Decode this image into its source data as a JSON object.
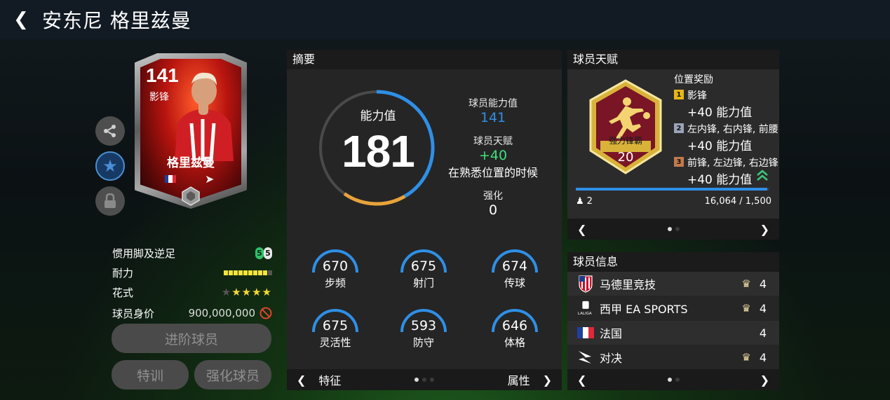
{
  "header": {
    "title": "安东尼 格里兹曼"
  },
  "card": {
    "rating": "141",
    "position": "影锋",
    "name": "格里兹曼"
  },
  "attributes": {
    "preferred_foot_label": "惯用脚及逆足",
    "foot_left": "5",
    "foot_right": "5",
    "stamina_label": "耐力",
    "stamina_level": 9,
    "skill_label": "花式",
    "skill_stars": 4,
    "value_label": "球员身价",
    "value": "900,000,000"
  },
  "buttons": {
    "advance": "进阶球员",
    "train": "特训",
    "enhance": "强化球员"
  },
  "summary": {
    "title": "摘要",
    "gauge_label": "能力值",
    "gauge_value": "181",
    "base_label": "球员能力值",
    "base_value": "141",
    "talent_label": "球员天赋",
    "talent_value": "+40",
    "talent_note": "在熟悉位置的时候",
    "enhance_label": "强化",
    "enhance_value": "0",
    "stats": [
      {
        "value": "670",
        "label": "步频"
      },
      {
        "value": "675",
        "label": "射门"
      },
      {
        "value": "674",
        "label": "传球"
      },
      {
        "value": "675",
        "label": "灵活性"
      },
      {
        "value": "593",
        "label": "防守"
      },
      {
        "value": "646",
        "label": "体格"
      }
    ],
    "footer_left": "特征",
    "footer_right": "属性"
  },
  "talent": {
    "title": "球员天赋",
    "badge_name": "强力锋霸",
    "badge_level": "20",
    "bonus_title": "位置奖励",
    "items": [
      {
        "num": "1",
        "positions": "影锋",
        "bonus": "+40 能力值",
        "color": "#e7b615"
      },
      {
        "num": "2",
        "positions": "左内锋, 右内锋, 前腰",
        "bonus": "+40 能力值",
        "color": "#9aa3b8"
      },
      {
        "num": "3",
        "positions": "前锋, 左边锋, 右边锋",
        "bonus": "+40 能力值",
        "color": "#c27a4c"
      }
    ],
    "count": "2",
    "progress": "16,064 / 1,500",
    "progress_fraction": 0.99
  },
  "player_info": {
    "title": "球员信息",
    "rows": [
      {
        "name": "马德里竞技",
        "count": "4",
        "icon": "atletico-crest-icon",
        "has_crown": true
      },
      {
        "name": "西甲 EA SPORTS",
        "count": "4",
        "icon": "laliga-icon",
        "has_crown": true
      },
      {
        "name": "法国",
        "count": "4",
        "icon": "france-flag-icon",
        "has_crown": false
      },
      {
        "name": "对决",
        "count": "4",
        "icon": "showdown-icon",
        "has_crown": true
      }
    ]
  },
  "colors": {
    "accent_blue": "#2f8fe6",
    "gauge_orange": "#e8a33a",
    "positive_green": "#3fe07a"
  }
}
